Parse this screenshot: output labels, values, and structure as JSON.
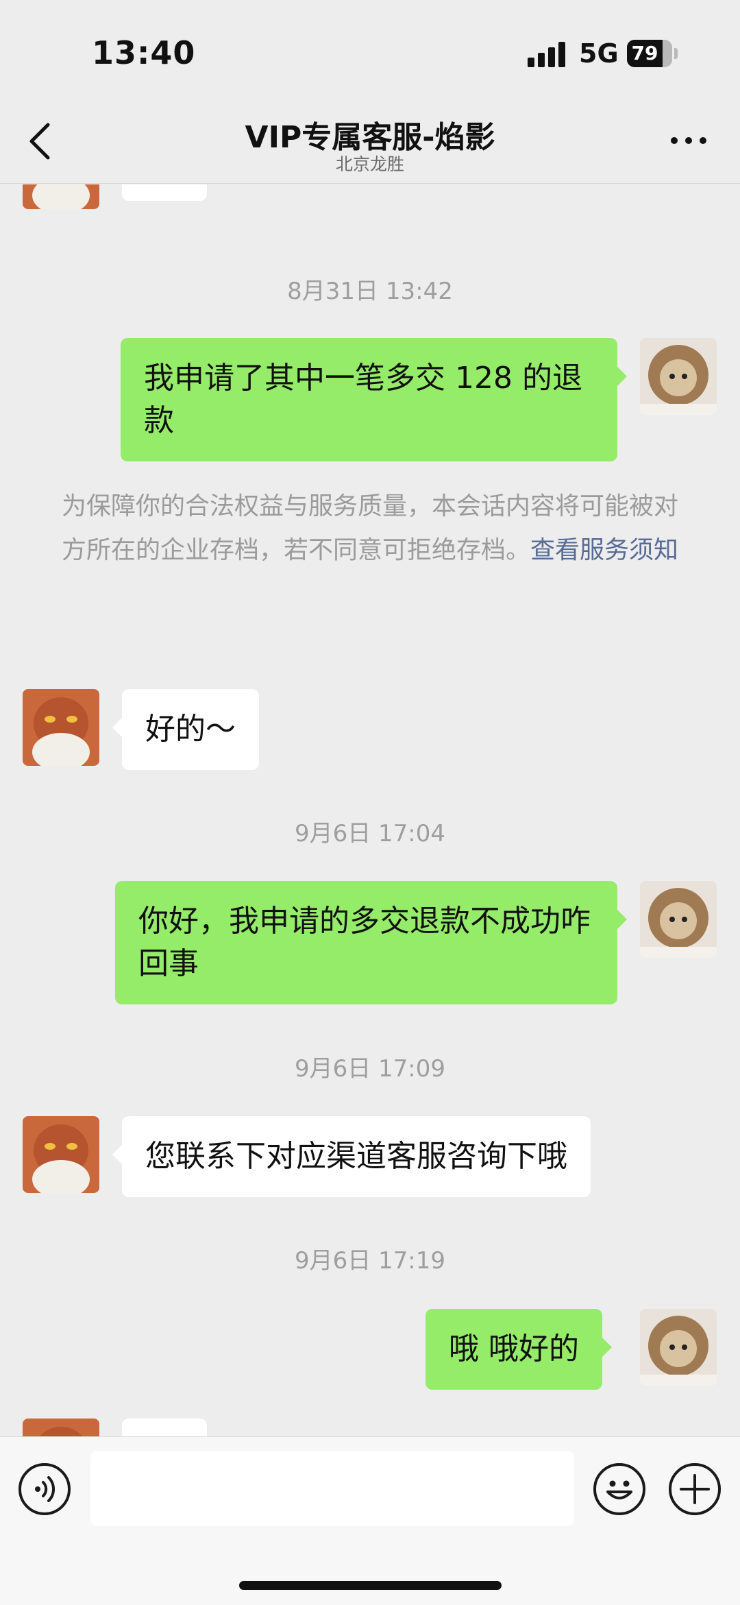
{
  "status_bar": {
    "time": "13:40",
    "network": "5G",
    "battery": "79",
    "battery_level": 0.79
  },
  "header": {
    "title": "VIP专属客服-焰影",
    "subtitle": "北京龙胜"
  },
  "messages": [
    {
      "type": "timestamp",
      "text": "8月31日 13:42"
    },
    {
      "type": "sent",
      "text": "我申请了其中一笔多交 128 的退款"
    },
    {
      "type": "notice",
      "text": "为保障你的合法权益与服务质量，本会话内容将可能被对方所在的企业存档，若不同意可拒绝存档。",
      "link": "查看服务须知"
    },
    {
      "type": "received",
      "text": "好的～"
    },
    {
      "type": "timestamp",
      "text": "9月6日 17:04"
    },
    {
      "type": "sent",
      "text": "你好，我申请的多交退款不成功咋回事"
    },
    {
      "type": "timestamp",
      "text": "9月6日 17:09"
    },
    {
      "type": "received",
      "text": "您联系下对应渠道客服咨询下哦"
    },
    {
      "type": "timestamp",
      "text": "9月6日 17:19"
    },
    {
      "type": "sent",
      "text": "哦 哦好的"
    }
  ],
  "input_bar": {
    "placeholder": "",
    "icons": [
      "voice-icon",
      "emoji-icon",
      "plus-icon"
    ]
  },
  "colors": {
    "background": "#ededed",
    "sent_bubble": "#95ec69",
    "received_bubble": "#ffffff",
    "link": "#576b95",
    "timestamp": "#9e9e9e"
  }
}
